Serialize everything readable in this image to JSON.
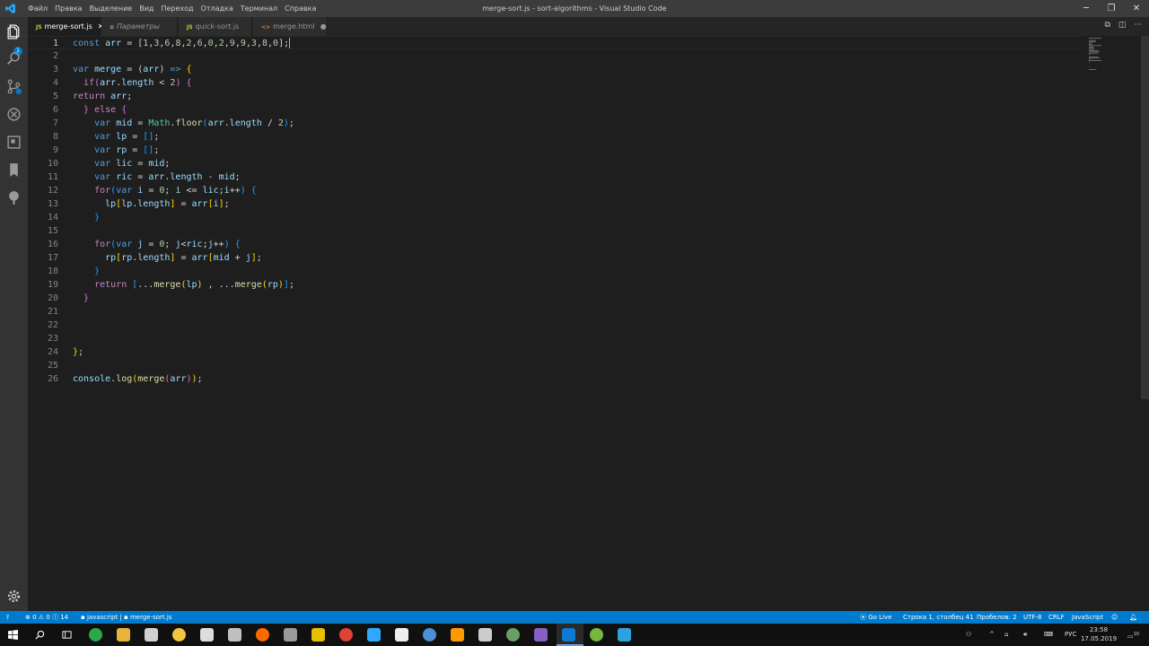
{
  "window": {
    "title": "merge-sort.js - sort-algorithms - Visual Studio Code"
  },
  "menu": [
    "Файл",
    "Правка",
    "Выделение",
    "Вид",
    "Переход",
    "Отладка",
    "Терминал",
    "Справка"
  ],
  "tabs": [
    {
      "label": "merge-sort.js",
      "icon": "JS",
      "state": "active"
    },
    {
      "label": "Параметры",
      "icon": "settings",
      "state": "inactive"
    },
    {
      "label": "quick-sort.js",
      "icon": "JS",
      "state": "inactive"
    },
    {
      "label": "merge.html",
      "icon": "<>",
      "state": "modified"
    }
  ],
  "activity": {
    "badge": "1"
  },
  "code": [
    {
      "n": "1",
      "t": [
        [
          "k",
          "const "
        ],
        [
          "v",
          "arr"
        ],
        [
          "p",
          " = ["
        ],
        [
          "n",
          "1"
        ],
        [
          "p",
          ","
        ],
        [
          "n",
          "3"
        ],
        [
          "p",
          ","
        ],
        [
          "n",
          "6"
        ],
        [
          "p",
          ","
        ],
        [
          "n",
          "8"
        ],
        [
          "p",
          ","
        ],
        [
          "n",
          "2"
        ],
        [
          "p",
          ","
        ],
        [
          "n",
          "6"
        ],
        [
          "p",
          ","
        ],
        [
          "n",
          "0"
        ],
        [
          "p",
          ","
        ],
        [
          "n",
          "2"
        ],
        [
          "p",
          ","
        ],
        [
          "n",
          "9"
        ],
        [
          "p",
          ","
        ],
        [
          "n",
          "9"
        ],
        [
          "p",
          ","
        ],
        [
          "n",
          "3"
        ],
        [
          "p",
          ","
        ],
        [
          "n",
          "8"
        ],
        [
          "p",
          ","
        ],
        [
          "n",
          "0"
        ],
        [
          "p",
          "];"
        ]
      ]
    },
    {
      "n": "2",
      "t": []
    },
    {
      "n": "3",
      "t": [
        [
          "k",
          "var "
        ],
        [
          "v",
          "merge"
        ],
        [
          "p",
          " = ("
        ],
        [
          "v",
          "arr"
        ],
        [
          "p",
          ") "
        ],
        [
          "k",
          "=>"
        ],
        [
          "y",
          " {"
        ]
      ]
    },
    {
      "n": "4",
      "t": [
        [
          "p",
          "  "
        ],
        [
          "c",
          "if"
        ],
        [
          "m",
          "("
        ],
        [
          "v",
          "arr"
        ],
        [
          "p",
          "."
        ],
        [
          "v",
          "length"
        ],
        [
          "p",
          " < "
        ],
        [
          "n",
          "2"
        ],
        [
          "m",
          ")"
        ],
        [
          "m",
          " {"
        ]
      ]
    },
    {
      "n": "5",
      "t": [
        [
          "c",
          "return "
        ],
        [
          "v",
          "arr"
        ],
        [
          "p",
          ";"
        ]
      ]
    },
    {
      "n": "6",
      "t": [
        [
          "p",
          "  "
        ],
        [
          "m",
          "}"
        ],
        [
          "c",
          " else "
        ],
        [
          "m",
          "{"
        ]
      ]
    },
    {
      "n": "7",
      "t": [
        [
          "p",
          "    "
        ],
        [
          "k",
          "var "
        ],
        [
          "v",
          "mid"
        ],
        [
          "p",
          " = "
        ],
        [
          "t",
          "Math"
        ],
        [
          "p",
          "."
        ],
        [
          "f",
          "floor"
        ],
        [
          "b",
          "("
        ],
        [
          "v",
          "arr"
        ],
        [
          "p",
          "."
        ],
        [
          "v",
          "length"
        ],
        [
          "p",
          " / "
        ],
        [
          "n",
          "2"
        ],
        [
          "b",
          ")"
        ],
        [
          "p",
          ";"
        ]
      ]
    },
    {
      "n": "8",
      "t": [
        [
          "p",
          "    "
        ],
        [
          "k",
          "var "
        ],
        [
          "v",
          "lp"
        ],
        [
          "p",
          " = "
        ],
        [
          "b",
          "[]"
        ],
        [
          "p",
          ";"
        ]
      ]
    },
    {
      "n": "9",
      "t": [
        [
          "p",
          "    "
        ],
        [
          "k",
          "var "
        ],
        [
          "v",
          "rp"
        ],
        [
          "p",
          " = "
        ],
        [
          "b",
          "[]"
        ],
        [
          "p",
          ";"
        ]
      ]
    },
    {
      "n": "10",
      "t": [
        [
          "p",
          "    "
        ],
        [
          "k",
          "var "
        ],
        [
          "v",
          "lic"
        ],
        [
          "p",
          " = "
        ],
        [
          "v",
          "mid"
        ],
        [
          "p",
          ";"
        ]
      ]
    },
    {
      "n": "11",
      "t": [
        [
          "p",
          "    "
        ],
        [
          "k",
          "var "
        ],
        [
          "v",
          "ric"
        ],
        [
          "p",
          " = "
        ],
        [
          "v",
          "arr"
        ],
        [
          "p",
          "."
        ],
        [
          "v",
          "length"
        ],
        [
          "p",
          " - "
        ],
        [
          "v",
          "mid"
        ],
        [
          "p",
          ";"
        ]
      ]
    },
    {
      "n": "12",
      "t": [
        [
          "p",
          "    "
        ],
        [
          "c",
          "for"
        ],
        [
          "b",
          "("
        ],
        [
          "k",
          "var "
        ],
        [
          "v",
          "i"
        ],
        [
          "p",
          " = "
        ],
        [
          "n",
          "0"
        ],
        [
          "p",
          "; "
        ],
        [
          "v",
          "i"
        ],
        [
          "p",
          " <= "
        ],
        [
          "v",
          "lic"
        ],
        [
          "p",
          ";"
        ],
        [
          "v",
          "i"
        ],
        [
          "p",
          "++"
        ],
        [
          "b",
          ")"
        ],
        [
          "b",
          " {"
        ]
      ]
    },
    {
      "n": "13",
      "t": [
        [
          "p",
          "      "
        ],
        [
          "v",
          "lp"
        ],
        [
          "y",
          "["
        ],
        [
          "v",
          "lp"
        ],
        [
          "p",
          "."
        ],
        [
          "v",
          "length"
        ],
        [
          "y",
          "]"
        ],
        [
          "p",
          " = "
        ],
        [
          "v",
          "arr"
        ],
        [
          "y",
          "["
        ],
        [
          "v",
          "i"
        ],
        [
          "y",
          "]"
        ],
        [
          "p",
          ";"
        ]
      ]
    },
    {
      "n": "14",
      "t": [
        [
          "p",
          "    "
        ],
        [
          "b",
          "}"
        ]
      ]
    },
    {
      "n": "15",
      "t": []
    },
    {
      "n": "16",
      "t": [
        [
          "p",
          "    "
        ],
        [
          "c",
          "for"
        ],
        [
          "b",
          "("
        ],
        [
          "k",
          "var "
        ],
        [
          "v",
          "j"
        ],
        [
          "p",
          " = "
        ],
        [
          "n",
          "0"
        ],
        [
          "p",
          "; "
        ],
        [
          "v",
          "j"
        ],
        [
          "p",
          "<"
        ],
        [
          "v",
          "ric"
        ],
        [
          "p",
          ";"
        ],
        [
          "v",
          "j"
        ],
        [
          "p",
          "++"
        ],
        [
          "b",
          ")"
        ],
        [
          "b",
          " {"
        ]
      ]
    },
    {
      "n": "17",
      "t": [
        [
          "p",
          "      "
        ],
        [
          "v",
          "rp"
        ],
        [
          "y",
          "["
        ],
        [
          "v",
          "rp"
        ],
        [
          "p",
          "."
        ],
        [
          "v",
          "length"
        ],
        [
          "y",
          "]"
        ],
        [
          "p",
          " = "
        ],
        [
          "v",
          "arr"
        ],
        [
          "y",
          "["
        ],
        [
          "v",
          "mid"
        ],
        [
          "p",
          " + "
        ],
        [
          "v",
          "j"
        ],
        [
          "y",
          "]"
        ],
        [
          "p",
          ";"
        ]
      ]
    },
    {
      "n": "18",
      "t": [
        [
          "p",
          "    "
        ],
        [
          "b",
          "}"
        ]
      ]
    },
    {
      "n": "19",
      "t": [
        [
          "p",
          "    "
        ],
        [
          "c",
          "return "
        ],
        [
          "b",
          "["
        ],
        [
          "p",
          "..."
        ],
        [
          "f",
          "merge"
        ],
        [
          "y",
          "("
        ],
        [
          "v",
          "lp"
        ],
        [
          "y",
          ")"
        ],
        [
          "p",
          " , ..."
        ],
        [
          "f",
          "merge"
        ],
        [
          "y",
          "("
        ],
        [
          "v",
          "rp"
        ],
        [
          "y",
          ")"
        ],
        [
          "b",
          "]"
        ],
        [
          "p",
          ";"
        ]
      ]
    },
    {
      "n": "20",
      "t": [
        [
          "p",
          "  "
        ],
        [
          "m",
          "}"
        ]
      ]
    },
    {
      "n": "21",
      "t": []
    },
    {
      "n": "22",
      "t": []
    },
    {
      "n": "23",
      "t": []
    },
    {
      "n": "24",
      "t": [
        [
          "y",
          "}"
        ],
        [
          "p",
          ";"
        ]
      ]
    },
    {
      "n": "25",
      "t": []
    },
    {
      "n": "26",
      "t": [
        [
          "v",
          "console"
        ],
        [
          "p",
          "."
        ],
        [
          "f",
          "log"
        ],
        [
          "y",
          "("
        ],
        [
          "f",
          "merge"
        ],
        [
          "m",
          "("
        ],
        [
          "v",
          "arr"
        ],
        [
          "m",
          ")"
        ],
        [
          "y",
          ")"
        ],
        [
          "p",
          ";"
        ]
      ]
    }
  ],
  "status": {
    "problems": "0",
    "warnings": "0",
    "info": "14",
    "language_mode": "javascript",
    "file": "merge-sort.js",
    "go_live": "Go Live",
    "position": "Строка 1, столбец 41",
    "spaces": "Пробелов: 2",
    "encoding": "UTF-8",
    "eol": "CRLF",
    "language": "JavaScript"
  },
  "taskbar": {
    "apps": [
      {
        "icon": "chrome-green-icon",
        "color": "#2aa84a"
      },
      {
        "icon": "file-explorer-icon",
        "color": "#e8b33c"
      },
      {
        "icon": "steam-icon",
        "color": "#d0d0d0"
      },
      {
        "icon": "python-icon",
        "color": "#f2c53d"
      },
      {
        "icon": "document-icon",
        "color": "#ddd"
      },
      {
        "icon": "cube-icon",
        "color": "#c0c0c0"
      },
      {
        "icon": "sync-icon",
        "color": "#ff6a00"
      },
      {
        "icon": "window-icon",
        "color": "#9a9a9a"
      },
      {
        "icon": "ball-icon",
        "color": "#e8c000"
      },
      {
        "icon": "chrome-icon",
        "color": "#e34133"
      },
      {
        "icon": "photoshop-icon",
        "color": "#31a8ff"
      },
      {
        "icon": "x-app-icon",
        "color": "#eee"
      },
      {
        "icon": "disk-icon",
        "color": "#4a90d9"
      },
      {
        "icon": "sublime-icon",
        "color": "#ff9800"
      },
      {
        "icon": "cloud-icon",
        "color": "#cccccc"
      },
      {
        "icon": "node-icon",
        "color": "#68a063"
      },
      {
        "icon": "visual-studio-icon",
        "color": "#8661c5"
      },
      {
        "icon": "vscode-icon",
        "color": "#0e7ad3"
      },
      {
        "icon": "utorrent-icon",
        "color": "#76b83f"
      },
      {
        "icon": "telegram-icon",
        "color": "#2aa3de"
      }
    ],
    "lang": "РУС",
    "time": "23:58",
    "date": "17.05.2019",
    "notif": "10"
  }
}
